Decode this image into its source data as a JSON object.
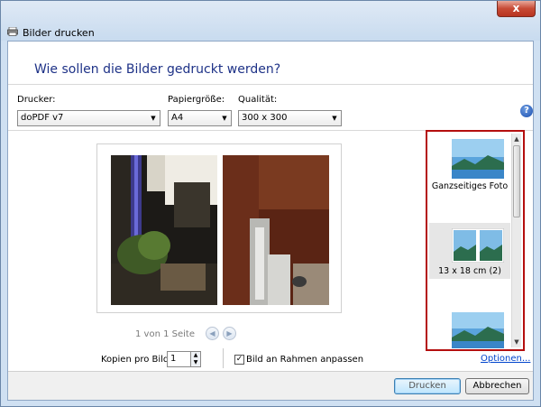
{
  "window": {
    "title": "Bilder drucken",
    "close_symbol": "x"
  },
  "heading": "Wie sollen die Bilder gedruckt werden?",
  "printer": {
    "label": "Drucker:",
    "value": "doPDF v7"
  },
  "paper": {
    "label": "Papiergröße:",
    "value": "A4"
  },
  "quality": {
    "label": "Qualität:",
    "value": "300 x 300"
  },
  "help": {
    "symbol": "?"
  },
  "preview": {
    "page_indicator": "1 von 1 Seite",
    "prev_symbol": "◀",
    "next_symbol": "▶"
  },
  "layouts": {
    "items": [
      {
        "label": "Ganzseitiges Foto",
        "selected": false
      },
      {
        "label": "13 x 18 cm (2)",
        "selected": true
      },
      {
        "label": "",
        "selected": false
      }
    ]
  },
  "copies": {
    "label": "Kopien pro Bild:",
    "value": "1"
  },
  "fit": {
    "label": "Bild an Rahmen anpassen",
    "checked": true,
    "check_symbol": "✓"
  },
  "options_link": "Optionen...",
  "buttons": {
    "print": "Drucken",
    "cancel": "Abbrechen"
  },
  "colors": {
    "accent": "#1e3287",
    "highlight": "#b40f0f",
    "link": "#0044cc"
  }
}
